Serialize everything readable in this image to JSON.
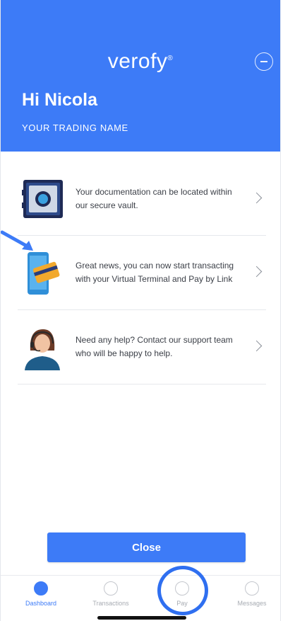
{
  "header": {
    "logo": "verofy",
    "logo_mark": "®",
    "greeting": "Hi Nicola",
    "trading_name": "YOUR TRADING NAME"
  },
  "items": [
    {
      "text": "Your documentation can be located within our secure vault.",
      "icon": "vault-icon"
    },
    {
      "text": "Great news, you can now start transacting with your Virtual Terminal and Pay by Link",
      "icon": "phone-card-icon"
    },
    {
      "text": "Need any help? Contact our support team who will be happy to help.",
      "icon": "support-agent-icon"
    }
  ],
  "close_label": "Close",
  "tabs": [
    {
      "label": "Dashboard",
      "active": true
    },
    {
      "label": "Transactions",
      "active": false
    },
    {
      "label": "Pay",
      "active": false
    },
    {
      "label": "Messages",
      "active": false
    }
  ],
  "colors": {
    "brand": "#3d7bf7",
    "highlight": "#2f6ff0"
  }
}
